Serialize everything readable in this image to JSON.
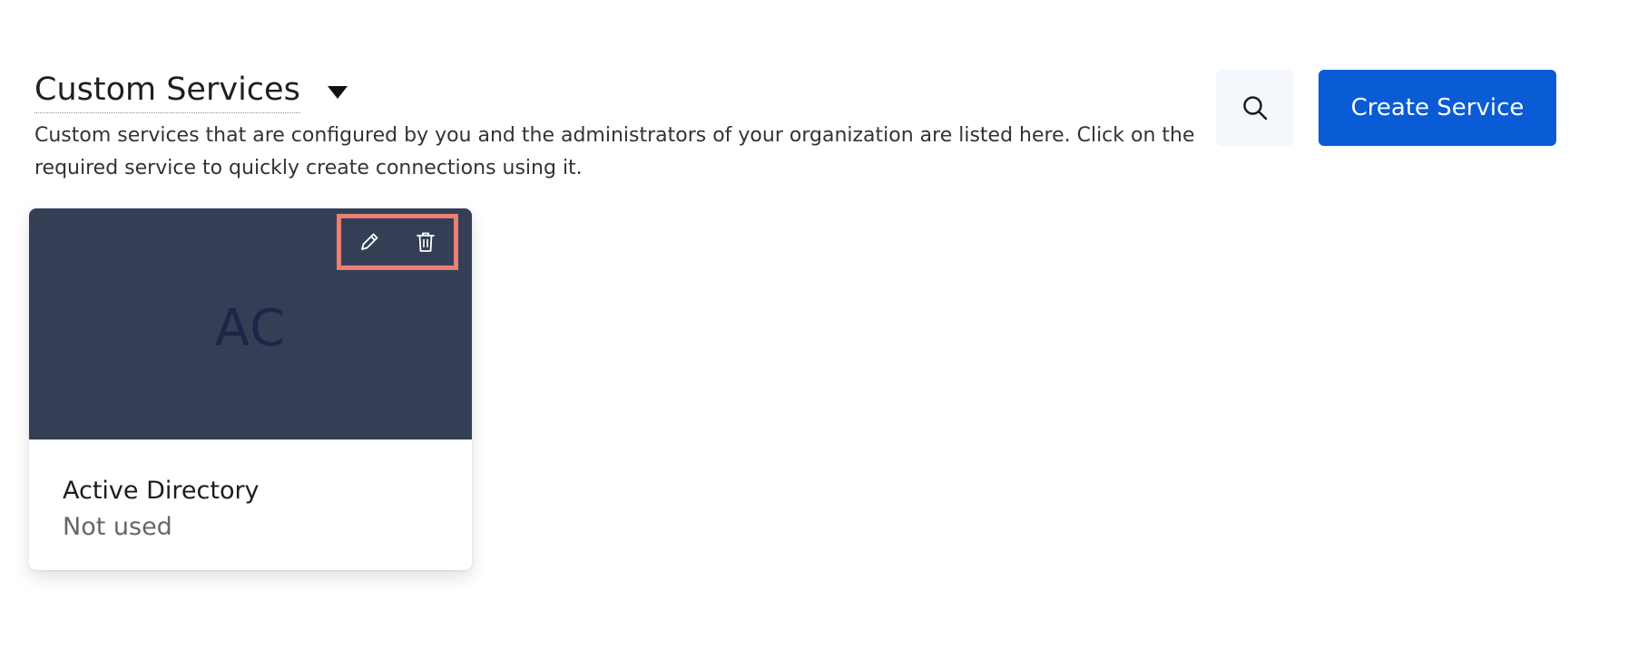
{
  "header": {
    "title": "Custom Services",
    "description": "Custom services that are configured by you and the administrators of your organization are listed here. Click on the required service to quickly create connections using it."
  },
  "toolbar": {
    "search_icon": "search-icon",
    "create_label": "Create Service"
  },
  "colors": {
    "primary": "#0a5bd6",
    "card_header": "#343f56",
    "highlight": "#ea7f72"
  },
  "services": [
    {
      "initials": "AC",
      "name": "Active Directory",
      "status": "Not used",
      "actions": [
        "edit-icon",
        "delete-icon"
      ]
    }
  ]
}
